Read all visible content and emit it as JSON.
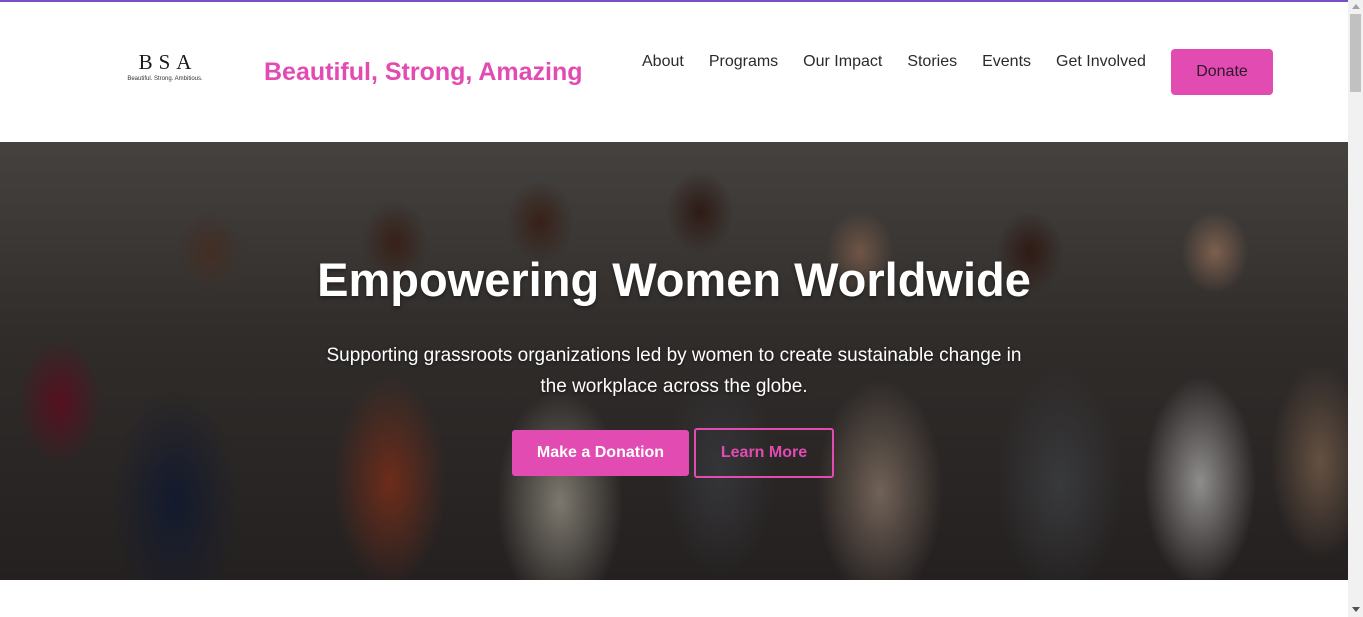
{
  "brand": {
    "logo_mark": "BSA",
    "logo_subtext": "Beautiful. Strong. Ambitious.",
    "tagline": "Beautiful, Strong, Amazing"
  },
  "nav": {
    "items": [
      {
        "label": "About"
      },
      {
        "label": "Programs"
      },
      {
        "label": "Our Impact"
      },
      {
        "label": "Stories"
      },
      {
        "label": "Events"
      },
      {
        "label": "Get Involved"
      }
    ],
    "donate_label": "Donate"
  },
  "hero": {
    "title": "Empowering Women Worldwide",
    "subtitle": "Supporting grassroots organizations led by women to create sustainable change in the workplace across the globe.",
    "primary_cta": "Make a Donation",
    "secondary_cta": "Learn More",
    "background_image": "group-of-professional-women-photo"
  },
  "colors": {
    "accent": "#e24bb2",
    "top_border": "#7b4fc4"
  }
}
